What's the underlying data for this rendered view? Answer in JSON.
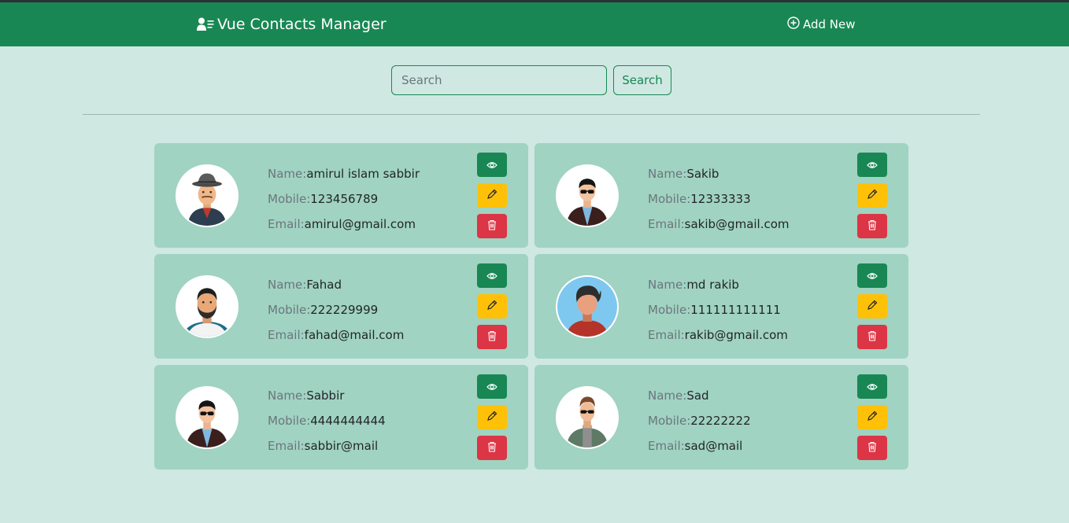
{
  "header": {
    "brand": "Vue Contacts Manager",
    "brand_icon": "contacts-icon",
    "add_new": "Add New",
    "add_icon": "plus-circle-icon"
  },
  "search": {
    "placeholder": "Search",
    "value": "",
    "button_label": "Search"
  },
  "labels": {
    "name": "Name:",
    "mobile": "Mobile:",
    "email": "Email:"
  },
  "actions": {
    "view_icon": "eye-icon",
    "edit_icon": "pencil-icon",
    "delete_icon": "trash-icon"
  },
  "colors": {
    "primary": "#198754",
    "warning": "#ffc107",
    "danger": "#dc3545",
    "background": "#cfe8e2",
    "card": "#a0d3c1"
  },
  "contacts": [
    {
      "name": "amirul islam sabbir",
      "mobile": "123456789",
      "email": "amirul@gmail.com",
      "avatar": "hat-man-avatar"
    },
    {
      "name": "Sakib",
      "mobile": "12333333",
      "email": "sakib@gmail.com",
      "avatar": "sunglasses-man-avatar"
    },
    {
      "name": "Fahad",
      "mobile": "222229999",
      "email": "fahad@mail.com",
      "avatar": "bearded-man-avatar"
    },
    {
      "name": "md rakib",
      "mobile": "111111111111",
      "email": "rakib@gmail.com",
      "avatar": "faceless-man-avatar"
    },
    {
      "name": "Sabbir",
      "mobile": "4444444444",
      "email": "sabbir@mail",
      "avatar": "sunglasses-man-avatar"
    },
    {
      "name": "Sad",
      "mobile": "22222222",
      "email": "sad@mail",
      "avatar": "jacket-man-avatar"
    }
  ]
}
